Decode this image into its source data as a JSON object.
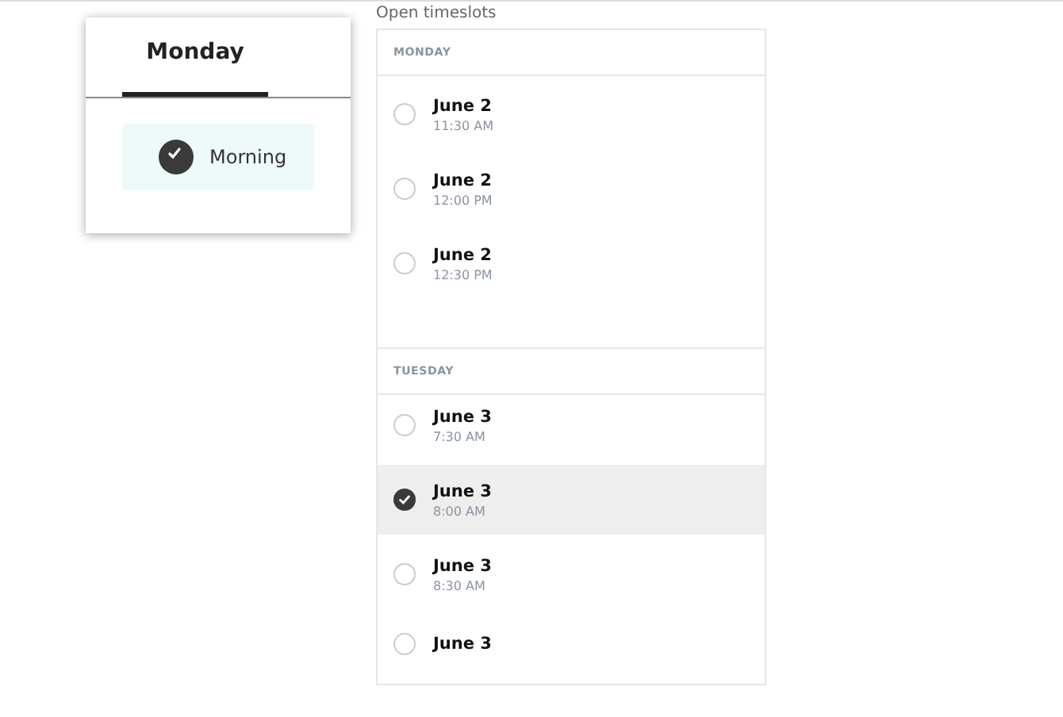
{
  "day_card": {
    "tabs": [
      {
        "label": "Monday",
        "selected": true
      }
    ],
    "periods": [
      {
        "label": "Morning",
        "selected": true
      }
    ]
  },
  "heading": "Open timeslots",
  "days": [
    {
      "name": "MONDAY",
      "slots": [
        {
          "date": "June 2",
          "time": "11:30 AM",
          "selected": false
        },
        {
          "date": "June 2",
          "time": "12:00 PM",
          "selected": false
        },
        {
          "date": "June 2",
          "time": "12:30 PM",
          "selected": false
        }
      ]
    },
    {
      "name": "TUESDAY",
      "slots": [
        {
          "date": "June 3",
          "time": "7:30 AM",
          "selected": false
        },
        {
          "date": "June 3",
          "time": "8:00 AM",
          "selected": true
        },
        {
          "date": "June 3",
          "time": "8:30 AM",
          "selected": false
        },
        {
          "date": "June 3",
          "selected": false
        }
      ]
    }
  ]
}
